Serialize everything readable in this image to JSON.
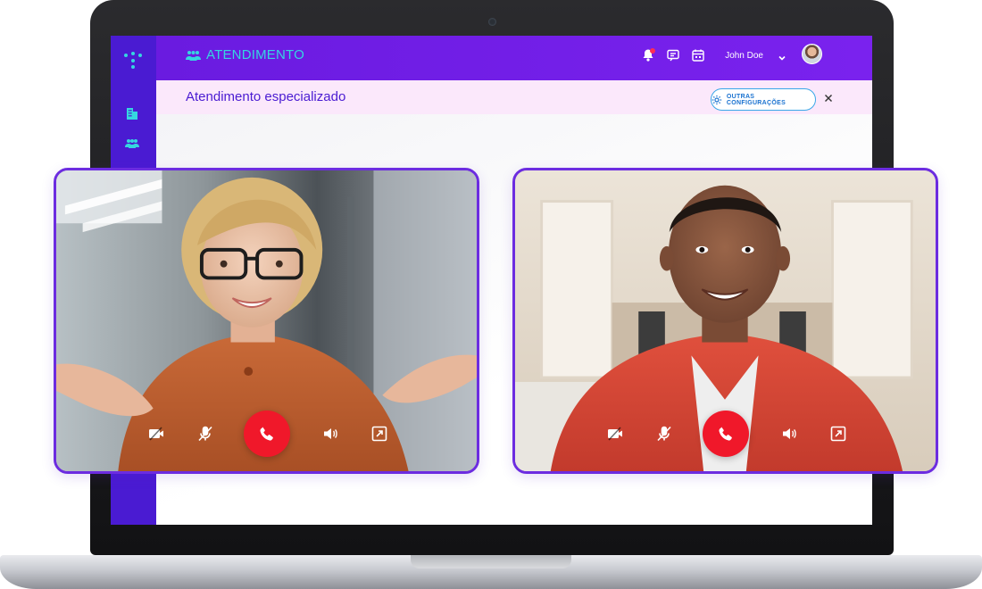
{
  "app": {
    "brand_title": "ATENDIMENTO",
    "subheader_title": "Atendimento especializado",
    "settings_button_label": "OUTRAS CONFIGURAÇÕES"
  },
  "user": {
    "name": "John Doe"
  },
  "sidebar": {
    "items": [
      {
        "icon": "building-icon"
      },
      {
        "icon": "users-icon"
      }
    ]
  },
  "topbar": {
    "icons": [
      "bell-icon",
      "chat-icon",
      "calendar-icon",
      "chevron-down-icon"
    ],
    "notification_dot": true
  },
  "calls": [
    {
      "participant": "left",
      "controls": [
        "camera-off-icon",
        "mic-off-icon",
        "hangup-icon",
        "speaker-icon",
        "expand-icon"
      ]
    },
    {
      "participant": "right",
      "controls": [
        "camera-off-icon",
        "mic-off-icon",
        "hangup-icon",
        "speaker-icon",
        "expand-icon"
      ]
    }
  ],
  "colors": {
    "primary": "#4a1bd2",
    "topbar": "#7a22ee",
    "accent": "#35d6e0",
    "subbar": "#fbe8fb",
    "hangup": "#f0182a",
    "card_border": "#6c2ce0"
  }
}
